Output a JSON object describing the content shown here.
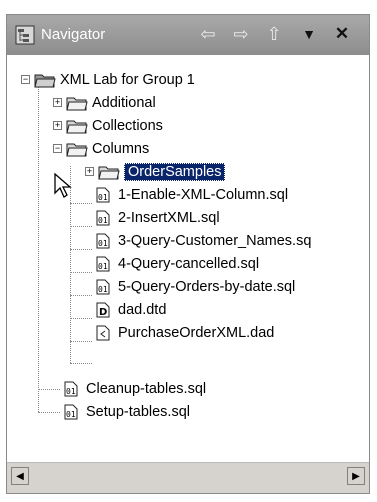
{
  "navigator": {
    "title": "Navigator",
    "toolbar": {
      "back_icon": "back-arrow-icon",
      "forward_icon": "forward-arrow-icon",
      "up_icon": "up-arrow-icon",
      "menu_icon": "view-menu-icon",
      "close_icon": "close-icon"
    }
  },
  "tree": {
    "root": "XML Lab for Group 1",
    "items": [
      {
        "label": "Additional"
      },
      {
        "label": "Collections"
      },
      {
        "label": "Columns"
      },
      {
        "label": "OrderSamples"
      },
      {
        "label": "1-Enable-XML-Column.sql"
      },
      {
        "label": "2-InsertXML.sql"
      },
      {
        "label": "3-Query-Customer_Names.sq"
      },
      {
        "label": "4-Query-cancelled.sql"
      },
      {
        "label": "5-Query-Orders-by-date.sql"
      },
      {
        "label": "dad.dtd"
      },
      {
        "label": "PurchaseOrderXML.dad"
      },
      {
        "label": "Cleanup-tables.sql"
      },
      {
        "label": "Setup-tables.sql"
      }
    ]
  },
  "colors": {
    "selection": "#0a246a",
    "titlebar": "#9b9b9b"
  }
}
